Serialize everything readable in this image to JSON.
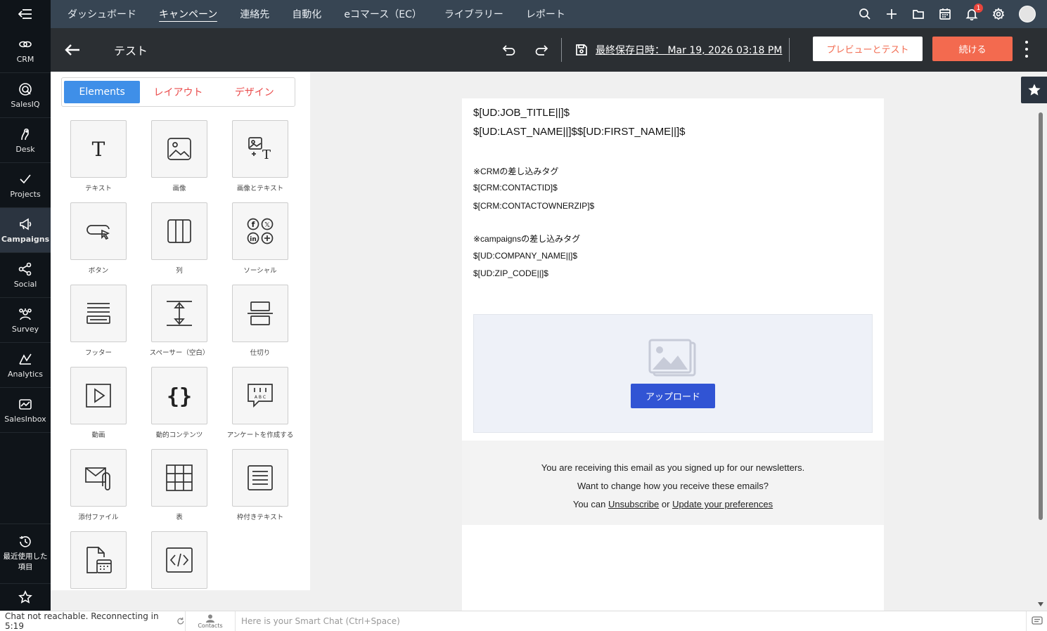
{
  "rail": {
    "apps": [
      {
        "label": "CRM",
        "icon": "crm-icon"
      },
      {
        "label": "SalesIQ",
        "icon": "salesiq-icon"
      },
      {
        "label": "Desk",
        "icon": "desk-icon"
      },
      {
        "label": "Projects",
        "icon": "projects-icon"
      },
      {
        "label": "Campaigns",
        "icon": "campaigns-icon"
      },
      {
        "label": "Social",
        "icon": "social-icon"
      },
      {
        "label": "Survey",
        "icon": "survey-icon"
      },
      {
        "label": "Analytics",
        "icon": "analytics-icon"
      },
      {
        "label": "SalesInbox",
        "icon": "salesinbox-icon"
      }
    ],
    "active": "Campaigns",
    "recent_label_1": "最近使用した",
    "recent_label_2": "項目"
  },
  "topnav": {
    "items": [
      "ダッシュボード",
      "キャンペーン",
      "連絡先",
      "自動化",
      "eコマース（EC）",
      "ライブラリー",
      "レポート"
    ],
    "active": "キャンペーン",
    "notification_count": "1"
  },
  "editor_header": {
    "title": "テスト",
    "last_saved": "最終保存日時： Mar 19, 2026 03:18 PM",
    "preview_label": "プレビューとテスト",
    "continue_label": "続ける"
  },
  "panel": {
    "tabs": [
      "Elements",
      "レイアウト",
      "デザイン"
    ],
    "active_tab": "Elements",
    "elements": [
      {
        "label": "テキスト",
        "icon": "text-icon"
      },
      {
        "label": "画像",
        "icon": "image-icon"
      },
      {
        "label": "画像とテキスト",
        "icon": "image-text-icon"
      },
      {
        "label": "ボタン",
        "icon": "button-icon"
      },
      {
        "label": "列",
        "icon": "columns-icon"
      },
      {
        "label": "ソーシャル",
        "icon": "social-icon"
      },
      {
        "label": "フッター",
        "icon": "footer-icon"
      },
      {
        "label": "スペーサー（空白）",
        "icon": "spacer-icon"
      },
      {
        "label": "仕切り",
        "icon": "divider-icon"
      },
      {
        "label": "動画",
        "icon": "video-icon"
      },
      {
        "label": "動的コンテンツ",
        "icon": "dynamic-content-icon"
      },
      {
        "label": "アンケートを作成する",
        "icon": "survey-icon"
      },
      {
        "label": "添付ファイル",
        "icon": "attachment-icon"
      },
      {
        "label": "表",
        "icon": "table-icon"
      },
      {
        "label": "枠付きテキスト",
        "icon": "boxed-text-icon"
      },
      {
        "label": "",
        "icon": "event-icon"
      },
      {
        "label": "",
        "icon": "html-code-icon"
      }
    ]
  },
  "email": {
    "line1": "$[UD:JOB_TITLE||]$",
    "line2": "$[UD:LAST_NAME||]$$[UD:FIRST_NAME||]$",
    "crm_heading": "※CRMの差し込みタグ",
    "crm_tag1": "$[CRM:CONTACTID]$",
    "crm_tag2": "$[CRM:CONTACTOWNERZIP]$",
    "campaigns_heading": "※campaignsの差し込みタグ",
    "ud_tag1": "$[UD:COMPANY_NAME||]$",
    "ud_tag2": "$[UD:ZIP_CODE||]$",
    "upload_label": "アップロード",
    "footer_line1": "You are receiving this email as you signed up for our newsletters.",
    "footer_line2": "Want to change how you receive these emails?",
    "footer_prefix": "You can",
    "footer_unsubscribe": "Unsubscribe",
    "footer_or": "or",
    "footer_update": "Update your preferences"
  },
  "bottombar": {
    "status": "Chat not reachable. Reconnecting in 5:19",
    "contacts_label": "Contacts",
    "chat_placeholder": "Here is your Smart Chat (Ctrl+Space)"
  },
  "colors": {
    "topnav_bg": "#374553",
    "editor_header_bg": "#2b2f33",
    "accent_orange": "#f36a4f",
    "tab_active_blue": "#3f8fe8",
    "upload_blue": "#3154d4"
  }
}
